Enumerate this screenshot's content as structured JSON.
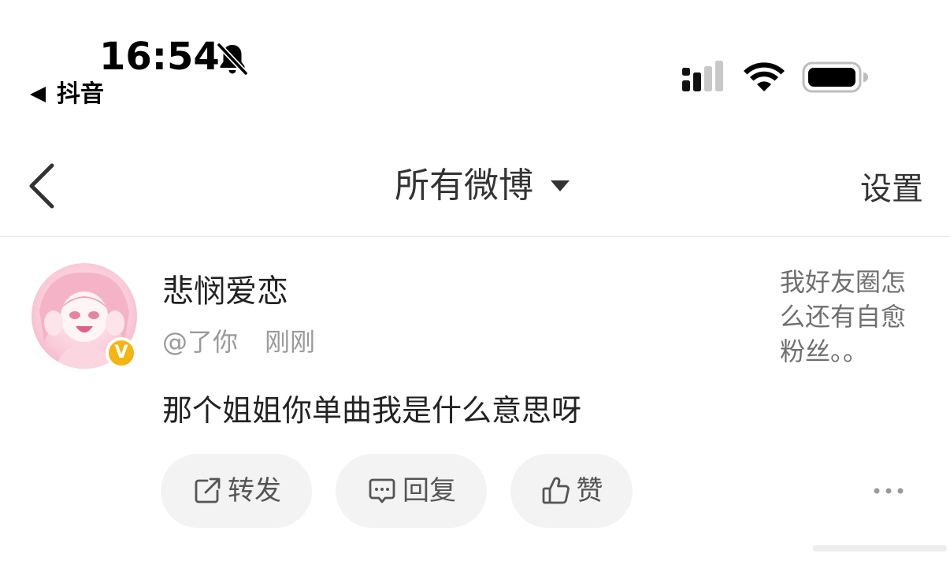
{
  "status_bar": {
    "time": "16:54",
    "back_app": "抖音"
  },
  "nav": {
    "title": "所有微博",
    "settings": "设置"
  },
  "post": {
    "username": "悲悯爱恋",
    "handle": "@了你",
    "time": "刚刚",
    "text": "那个姐姐你单曲我是什么意思呀",
    "quote_lines": [
      "我好友圈怎",
      "么还有自愈",
      "粉丝。。"
    ],
    "verified_badge": "V"
  },
  "actions": {
    "repost": "转发",
    "reply": "回复",
    "like": "赞"
  },
  "colors": {
    "text_primary": "#222222",
    "text_secondary": "#9a9a9a",
    "button_bg": "#f3f3f3",
    "verified_badge": "#f5b511"
  },
  "icons": [
    "bell-slash-icon",
    "back-triangle-icon",
    "signal-icon",
    "wifi-icon",
    "battery-icon",
    "chevron-left-icon",
    "caret-down-icon",
    "verified-icon",
    "share-icon",
    "comment-icon",
    "thumbs-up-icon",
    "more-icon"
  ]
}
